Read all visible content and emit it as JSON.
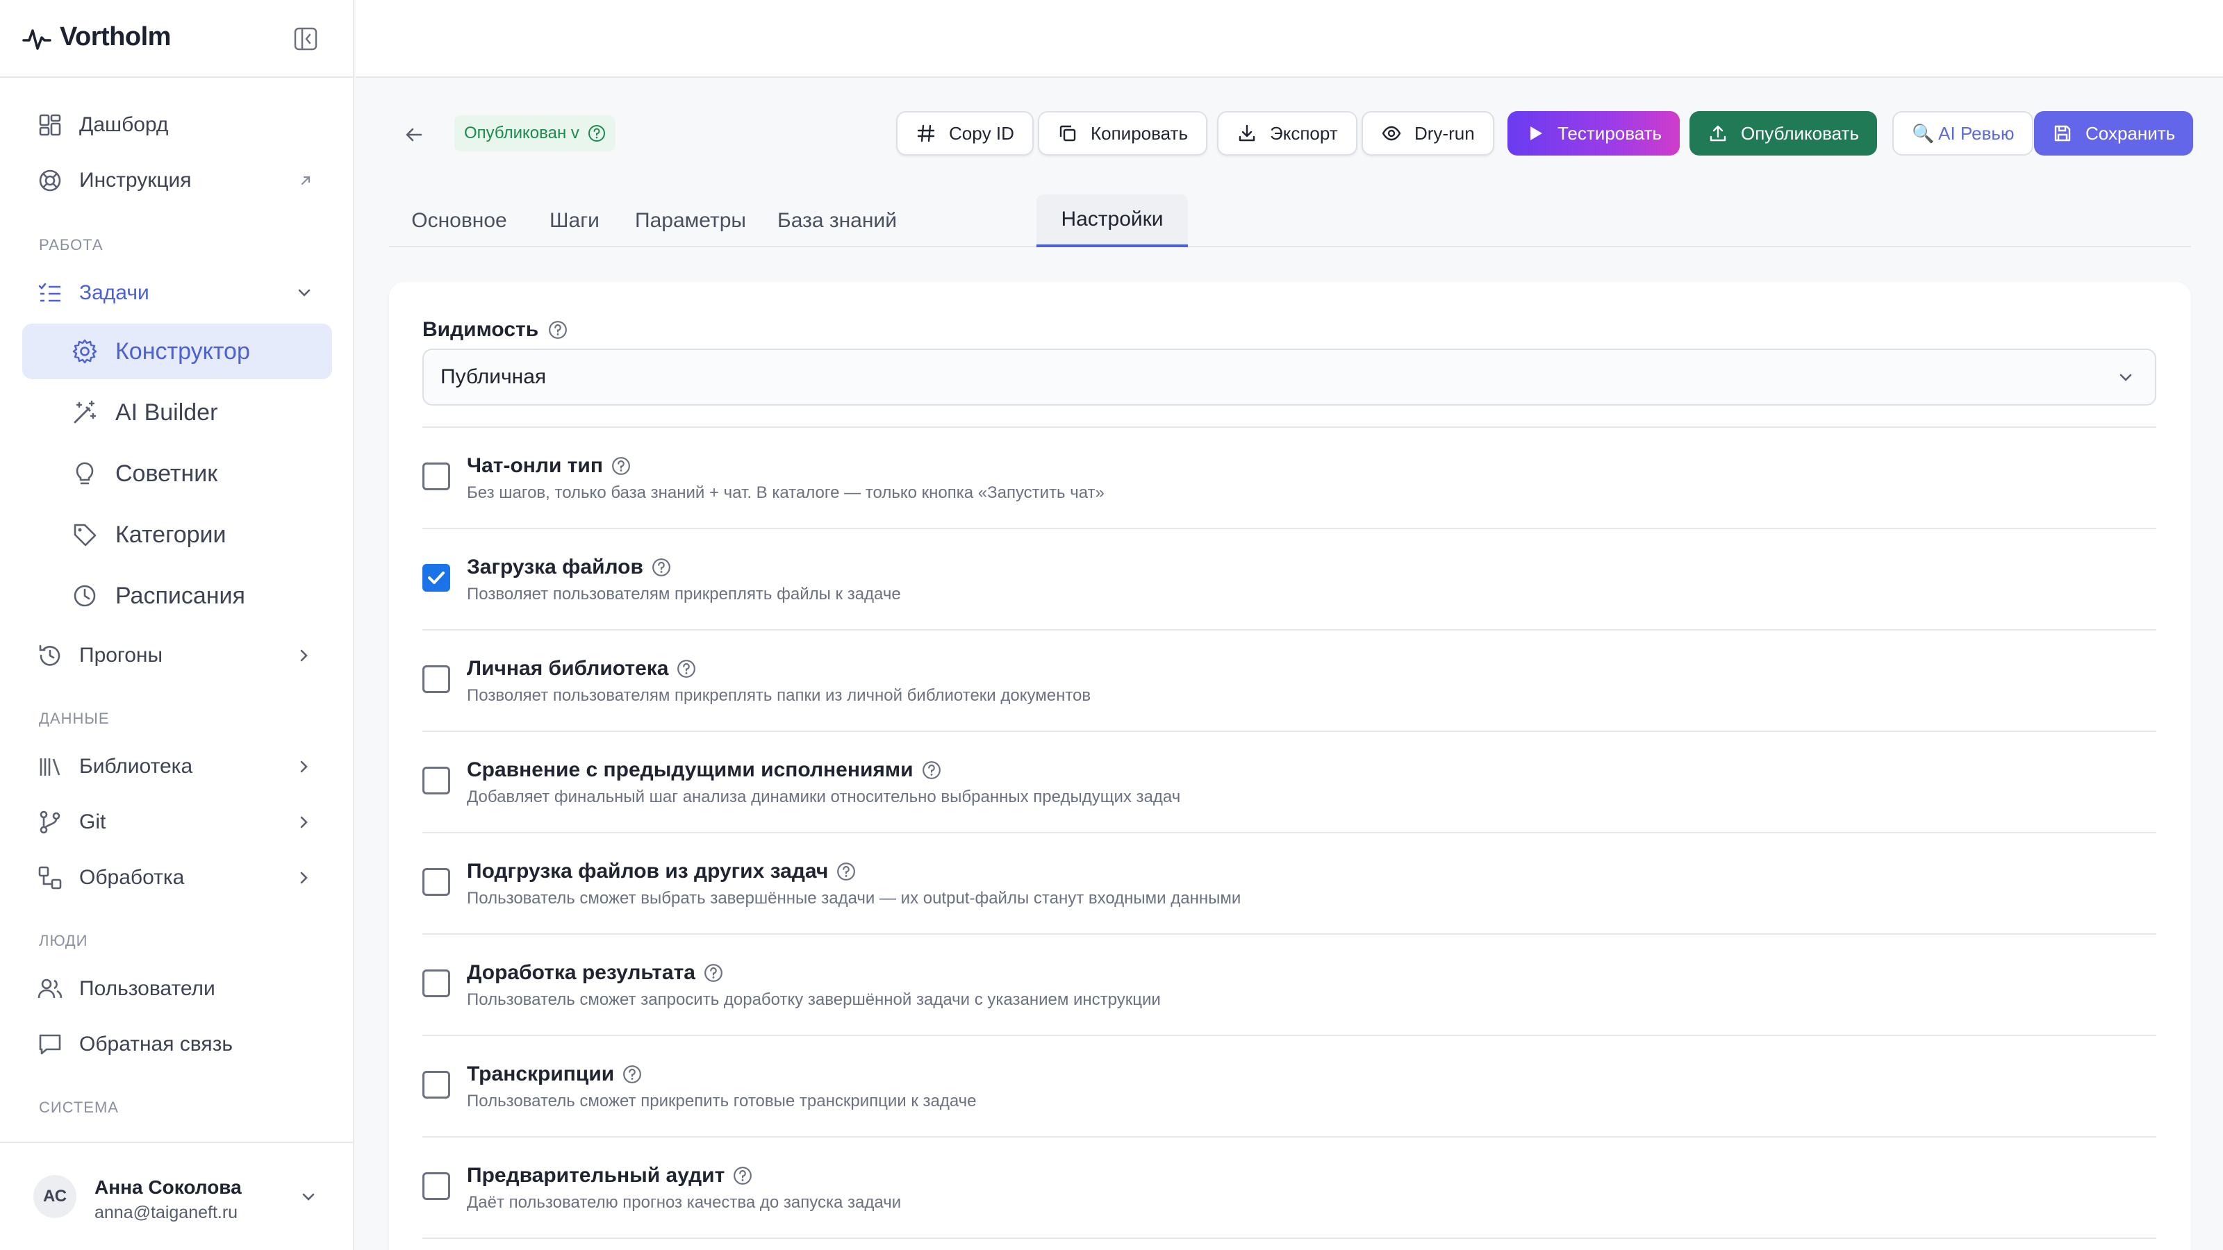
{
  "app": {
    "name": "Vortholm"
  },
  "sidebar": {
    "items_top": [
      {
        "label": "Дашборд"
      },
      {
        "label": "Инструкция"
      }
    ],
    "sections": {
      "work": "РАБОТА",
      "data": "ДАННЫЕ",
      "people": "ЛЮДИ",
      "system": "СИСТЕМА"
    },
    "tasks": {
      "label": "Задачи"
    },
    "tasks_sub": [
      {
        "label": "Конструктор"
      },
      {
        "label": "AI Builder"
      },
      {
        "label": "Советник"
      },
      {
        "label": "Категории"
      },
      {
        "label": "Расписания"
      }
    ],
    "runs": {
      "label": "Прогоны"
    },
    "data_items": [
      {
        "label": "Библиотека"
      },
      {
        "label": "Git"
      },
      {
        "label": "Обработка"
      }
    ],
    "people_items": [
      {
        "label": "Пользователи"
      },
      {
        "label": "Обратная связь"
      }
    ],
    "user": {
      "initials": "АС",
      "name": "Анна Соколова",
      "email": "anna@taiganeft.ru"
    }
  },
  "toolbar": {
    "status": "Опубликован v",
    "copy_id": "Copy ID",
    "copy": "Копировать",
    "export": "Экспорт",
    "dry_run": "Dry-run",
    "test": "Тестировать",
    "publish": "Опубликовать",
    "ai_review": "🔍 AI Ревью",
    "save": "Сохранить"
  },
  "tabs": [
    {
      "label": "Основное"
    },
    {
      "label": "Шаги"
    },
    {
      "label": "Параметры"
    },
    {
      "label": "База знаний"
    },
    {
      "label": "Настройки"
    }
  ],
  "active_tab": "Настройки",
  "settings": {
    "visibility_label": "Видимость",
    "visibility_value": "Публичная",
    "options": [
      {
        "title": "Чат-онли тип",
        "desc": "Без шагов, только база знаний + чат. В каталоге — только кнопка «Запустить чат»",
        "checked": false
      },
      {
        "title": "Загрузка файлов",
        "desc": "Позволяет пользователям прикреплять файлы к задаче",
        "checked": true
      },
      {
        "title": "Личная библиотека",
        "desc": "Позволяет пользователям прикреплять папки из личной библиотеки документов",
        "checked": false
      },
      {
        "title": "Сравнение с предыдущими исполнениями",
        "desc": "Добавляет финальный шаг анализа динамики относительно выбранных предыдущих задач",
        "checked": false
      },
      {
        "title": "Подгрузка файлов из других задач",
        "desc": "Пользователь сможет выбрать завершённые задачи — их output-файлы станут входными данными",
        "checked": false
      },
      {
        "title": "Доработка результата",
        "desc": "Пользователь сможет запросить доработку завершённой задачи с указанием инструкции",
        "checked": false
      },
      {
        "title": "Транскрипции",
        "desc": "Пользователь сможет прикрепить готовые транскрипции к задаче",
        "checked": false
      },
      {
        "title": "Предварительный аудит",
        "desc": "Даёт пользователю прогноз качества до запуска задачи",
        "checked": false
      }
    ]
  },
  "colors": {
    "accent": "#4b61d4",
    "publish": "#1f7a55",
    "save": "#6366e8",
    "checkbox": "#1a73e8"
  }
}
